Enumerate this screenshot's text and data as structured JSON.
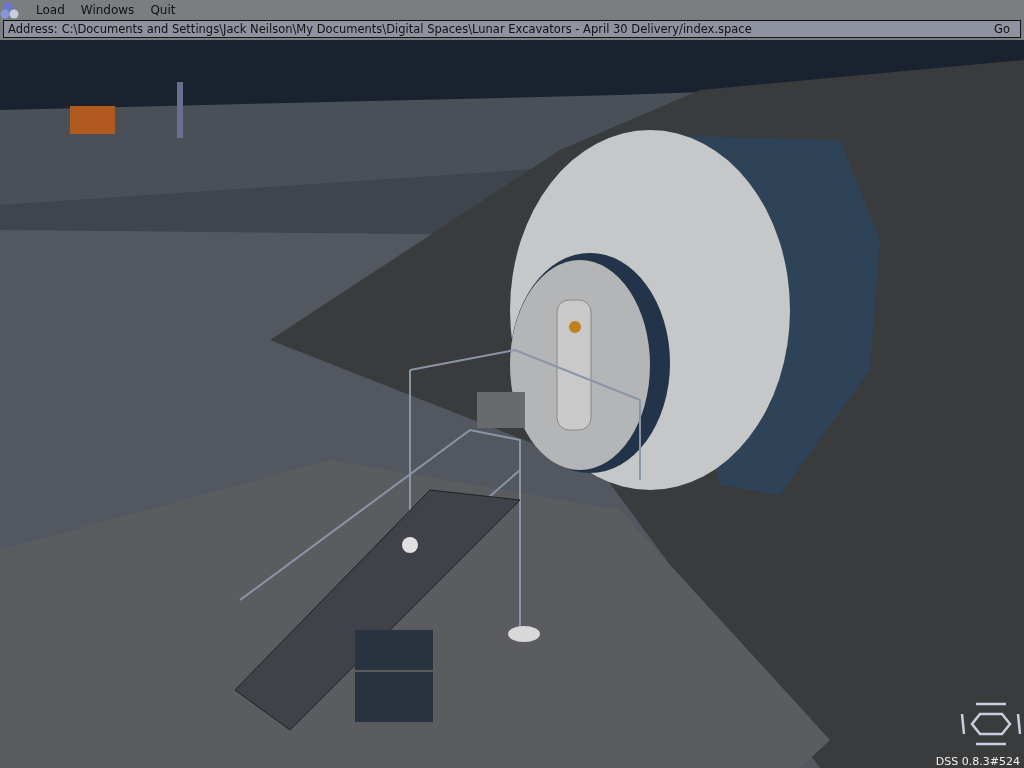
{
  "menu_bar": {
    "items": [
      "Load",
      "Windows",
      "Quit"
    ]
  },
  "address_bar": {
    "label": "Address:",
    "value": "C:\\Documents and Settings\\Jack Neilson\\My Documents\\Digital Spaces\\Lunar Excavators - April 30 Delivery/index.space",
    "button": "Go"
  },
  "viewport": {
    "version": "DSS 0.8.3#524"
  }
}
